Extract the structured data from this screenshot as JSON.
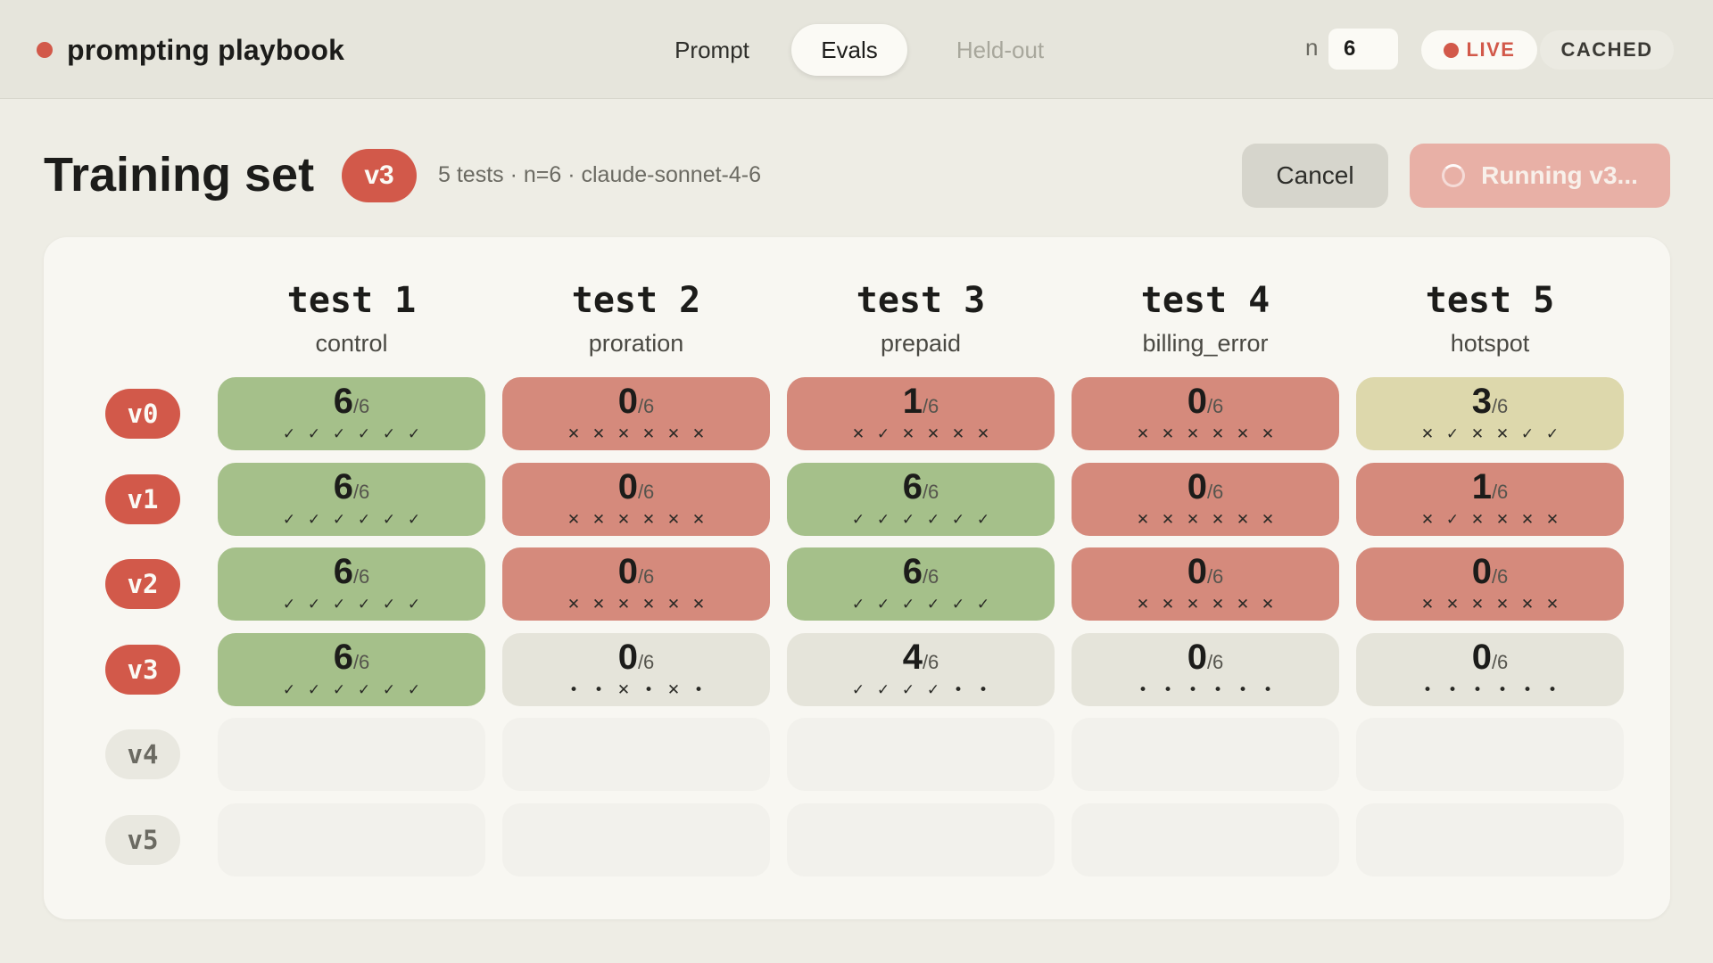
{
  "app": {
    "title": "prompting playbook",
    "brand_color": "#d2594a"
  },
  "tabs": [
    {
      "label": "Prompt",
      "state": "normal"
    },
    {
      "label": "Evals",
      "state": "active"
    },
    {
      "label": "Held-out",
      "state": "disabled"
    }
  ],
  "controls": {
    "n_label": "n",
    "n_value": "6",
    "live_label": "LIVE",
    "cached_label": "CACHED",
    "active_mode": "LIVE"
  },
  "header": {
    "title": "Training set",
    "version": "v3",
    "meta": "5 tests · n=6 · claude-sonnet-4-6",
    "cancel_label": "Cancel",
    "run_label": "Running v3..."
  },
  "columns": [
    {
      "title": "test 1",
      "subtitle": "control"
    },
    {
      "title": "test 2",
      "subtitle": "proration"
    },
    {
      "title": "test 3",
      "subtitle": "prepaid"
    },
    {
      "title": "test 4",
      "subtitle": "billing_error"
    },
    {
      "title": "test 5",
      "subtitle": "hotspot"
    }
  ],
  "rows": [
    {
      "version": "v0",
      "active": true,
      "cells": [
        {
          "score": "6",
          "total": "/6",
          "status": "pass",
          "marks": [
            "✓",
            "✓",
            "✓",
            "✓",
            "✓",
            "✓"
          ]
        },
        {
          "score": "0",
          "total": "/6",
          "status": "fail",
          "marks": [
            "✕",
            "✕",
            "✕",
            "✕",
            "✕",
            "✕"
          ]
        },
        {
          "score": "1",
          "total": "/6",
          "status": "fail",
          "marks": [
            "✕",
            "✓",
            "✕",
            "✕",
            "✕",
            "✕"
          ]
        },
        {
          "score": "0",
          "total": "/6",
          "status": "fail",
          "marks": [
            "✕",
            "✕",
            "✕",
            "✕",
            "✕",
            "✕"
          ]
        },
        {
          "score": "3",
          "total": "/6",
          "status": "partial",
          "marks": [
            "✕",
            "✓",
            "✕",
            "✕",
            "✓",
            "✓"
          ]
        }
      ]
    },
    {
      "version": "v1",
      "active": true,
      "cells": [
        {
          "score": "6",
          "total": "/6",
          "status": "pass",
          "marks": [
            "✓",
            "✓",
            "✓",
            "✓",
            "✓",
            "✓"
          ]
        },
        {
          "score": "0",
          "total": "/6",
          "status": "fail",
          "marks": [
            "✕",
            "✕",
            "✕",
            "✕",
            "✕",
            "✕"
          ]
        },
        {
          "score": "6",
          "total": "/6",
          "status": "pass",
          "marks": [
            "✓",
            "✓",
            "✓",
            "✓",
            "✓",
            "✓"
          ]
        },
        {
          "score": "0",
          "total": "/6",
          "status": "fail",
          "marks": [
            "✕",
            "✕",
            "✕",
            "✕",
            "✕",
            "✕"
          ]
        },
        {
          "score": "1",
          "total": "/6",
          "status": "fail",
          "marks": [
            "✕",
            "✓",
            "✕",
            "✕",
            "✕",
            "✕"
          ]
        }
      ]
    },
    {
      "version": "v2",
      "active": true,
      "cells": [
        {
          "score": "6",
          "total": "/6",
          "status": "pass",
          "marks": [
            "✓",
            "✓",
            "✓",
            "✓",
            "✓",
            "✓"
          ]
        },
        {
          "score": "0",
          "total": "/6",
          "status": "fail",
          "marks": [
            "✕",
            "✕",
            "✕",
            "✕",
            "✕",
            "✕"
          ]
        },
        {
          "score": "6",
          "total": "/6",
          "status": "pass",
          "marks": [
            "✓",
            "✓",
            "✓",
            "✓",
            "✓",
            "✓"
          ]
        },
        {
          "score": "0",
          "total": "/6",
          "status": "fail",
          "marks": [
            "✕",
            "✕",
            "✕",
            "✕",
            "✕",
            "✕"
          ]
        },
        {
          "score": "0",
          "total": "/6",
          "status": "fail",
          "marks": [
            "✕",
            "✕",
            "✕",
            "✕",
            "✕",
            "✕"
          ]
        }
      ]
    },
    {
      "version": "v3",
      "active": true,
      "cells": [
        {
          "score": "6",
          "total": "/6",
          "status": "pass",
          "marks": [
            "✓",
            "✓",
            "✓",
            "✓",
            "✓",
            "✓"
          ]
        },
        {
          "score": "0",
          "total": "/6",
          "status": "pending",
          "marks": [
            "•",
            "•",
            "✕",
            "•",
            "✕",
            "•"
          ]
        },
        {
          "score": "4",
          "total": "/6",
          "status": "pending",
          "marks": [
            "✓",
            "✓",
            "✓",
            "✓",
            "•",
            "•"
          ]
        },
        {
          "score": "0",
          "total": "/6",
          "status": "pending",
          "marks": [
            "•",
            "•",
            "•",
            "•",
            "•",
            "•"
          ]
        },
        {
          "score": "0",
          "total": "/6",
          "status": "pending",
          "marks": [
            "•",
            "•",
            "•",
            "•",
            "•",
            "•"
          ]
        }
      ]
    },
    {
      "version": "v4",
      "active": false,
      "cells": [
        {
          "status": "empty"
        },
        {
          "status": "empty"
        },
        {
          "status": "empty"
        },
        {
          "status": "empty"
        },
        {
          "status": "empty"
        }
      ]
    },
    {
      "version": "v5",
      "active": false,
      "cells": [
        {
          "status": "empty"
        },
        {
          "status": "empty"
        },
        {
          "status": "empty"
        },
        {
          "status": "empty"
        },
        {
          "status": "empty"
        }
      ]
    }
  ],
  "colors": {
    "pass": "#a5c08a",
    "fail": "#d58a7c",
    "partial": "#ddd8ac",
    "pending": "#e5e4da",
    "empty": "#f2f1ec"
  }
}
